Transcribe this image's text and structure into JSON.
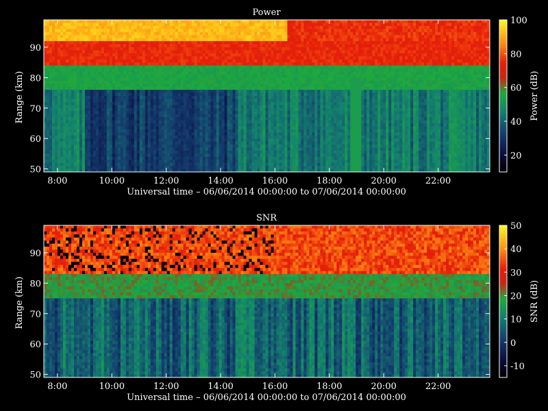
{
  "chart_data": [
    {
      "type": "heatmap",
      "title": "Power",
      "xlabel": "Universal time – 06/06/2014 00:00:00 to 07/06/2014 00:00:00",
      "ylabel": "Range (km)",
      "xlim": [
        7.5,
        23.9
      ],
      "ylim": [
        49,
        99
      ],
      "xticks": [
        "8:00",
        "10:00",
        "12:00",
        "14:00",
        "16:00",
        "18:00",
        "20:00",
        "22:00"
      ],
      "xtick_values": [
        8,
        10,
        12,
        14,
        16,
        18,
        20,
        22
      ],
      "yticks": [
        "50",
        "60",
        "70",
        "80",
        "90"
      ],
      "ytick_values": [
        50,
        60,
        70,
        80,
        90
      ],
      "colorbar": {
        "label": "Power (dB)",
        "min": 10,
        "max": 100,
        "ticks": [
          "20",
          "40",
          "60",
          "80",
          "100"
        ],
        "tick_values": [
          20,
          40,
          60,
          80,
          100
        ]
      },
      "colormap": "rainbow-black-blue-green-red-yellow"
    },
    {
      "type": "heatmap",
      "title": "SNR",
      "xlabel": "Universal time – 06/06/2014 00:00:00 to 07/06/2014 00:00:00",
      "ylabel": "Range (km)",
      "xlim": [
        7.5,
        23.9
      ],
      "ylim": [
        49,
        99
      ],
      "xticks": [
        "8:00",
        "10:00",
        "12:00",
        "14:00",
        "16:00",
        "18:00",
        "20:00",
        "22:00"
      ],
      "xtick_values": [
        8,
        10,
        12,
        14,
        16,
        18,
        20,
        22
      ],
      "yticks": [
        "50",
        "60",
        "70",
        "80",
        "90"
      ],
      "ytick_values": [
        50,
        60,
        70,
        80,
        90
      ],
      "colorbar": {
        "label": "SNR (dB)",
        "min": -15,
        "max": 50,
        "ticks": [
          "-10",
          "0",
          "10",
          "20",
          "30",
          "40",
          "50"
        ],
        "tick_values": [
          -10,
          0,
          10,
          20,
          30,
          40,
          50
        ]
      },
      "colormap": "rainbow-black-blue-green-red-yellow"
    }
  ]
}
